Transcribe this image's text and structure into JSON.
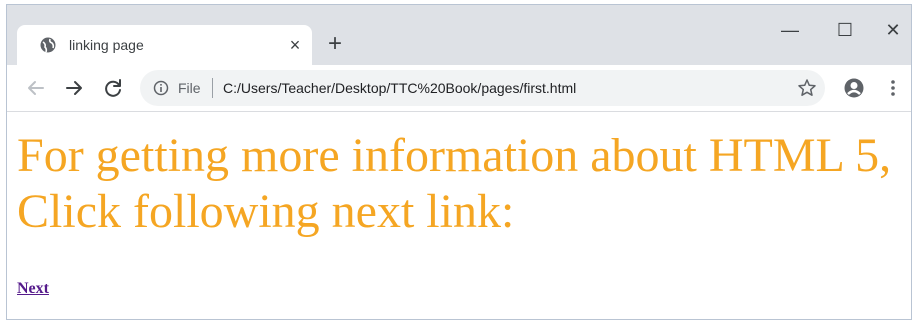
{
  "browser": {
    "tab": {
      "title": "linking page",
      "favicon": "globe-icon"
    },
    "window_controls": {
      "minimize": "—",
      "maximize": "☐",
      "close": "✕"
    },
    "new_tab_symbol": "+",
    "address_bar": {
      "scheme_label": "File",
      "url": "C:/Users/Teacher/Desktop/TTC%20Book/pages/first.html"
    }
  },
  "page": {
    "heading": "For getting more information about HTML 5, Click following next link:",
    "link_text": "Next",
    "heading_color": "#f5a623",
    "link_color": "#551a8b"
  }
}
